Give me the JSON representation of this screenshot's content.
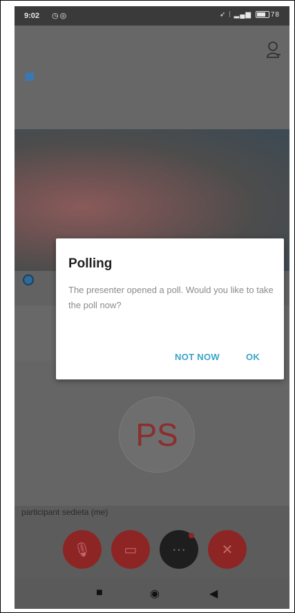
{
  "status_bar": {
    "time": "9:02",
    "left_icons": [
      "alarm-icon",
      "sync-icon"
    ],
    "right_icons": [
      "location-icon",
      "vibrate-icon",
      "signal-icon",
      "battery-icon"
    ],
    "battery": "78"
  },
  "app": {
    "participant_name": "participant sedieta (me)",
    "avatar_initials": "PS",
    "controls": [
      "mic-button",
      "camera-button",
      "more-button",
      "end-call-button"
    ],
    "accent_color": "#8e2525"
  },
  "dialog": {
    "title": "Polling",
    "message": "The presenter opened a poll. Would you like to take the poll now?",
    "negative_label": "NOT NOW",
    "positive_label": "OK",
    "action_color": "#3aa3c7"
  },
  "navbar": {
    "recents": "■",
    "home": "◉",
    "back": "◀"
  }
}
